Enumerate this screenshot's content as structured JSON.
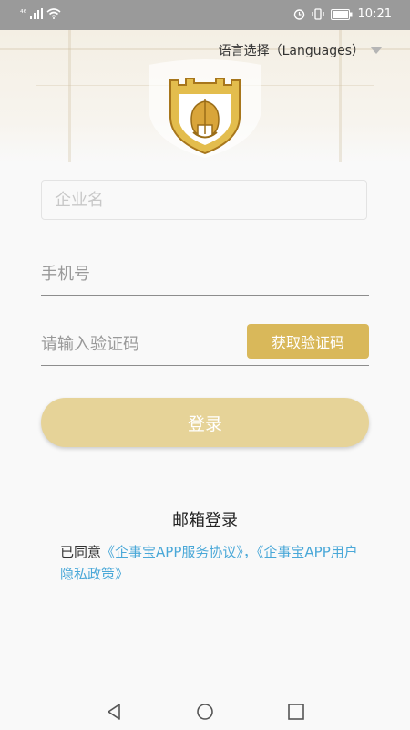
{
  "status_bar": {
    "signal_label": "⁴⁶",
    "time": "10:21",
    "icons": [
      "signal-icon",
      "wifi-icon",
      "alarm-icon",
      "vibrate-icon",
      "battery-icon"
    ]
  },
  "header": {
    "language_selector": "语言选择（Languages）",
    "logo_icon": "helmet-shield-logo"
  },
  "form": {
    "company_placeholder": "企业名",
    "phone_placeholder": "手机号",
    "code_placeholder": "请输入验证码",
    "get_code_label": "获取验证码",
    "login_label": "登录"
  },
  "links": {
    "email_login": "邮箱登录",
    "agree_prefix": "已同意",
    "service_agreement": "《企事宝APP服务协议》",
    "separator": "，",
    "privacy_policy": "《企事宝APP用户隐私政策》"
  },
  "navigation": {
    "icons": [
      "back-triangle-icon",
      "home-circle-icon",
      "recents-square-icon"
    ]
  },
  "colors": {
    "accent_gold": "#d9b85a",
    "login_button": "#e6d398",
    "link_blue": "#4aa8d8",
    "status_bar": "#9a9a9a"
  }
}
